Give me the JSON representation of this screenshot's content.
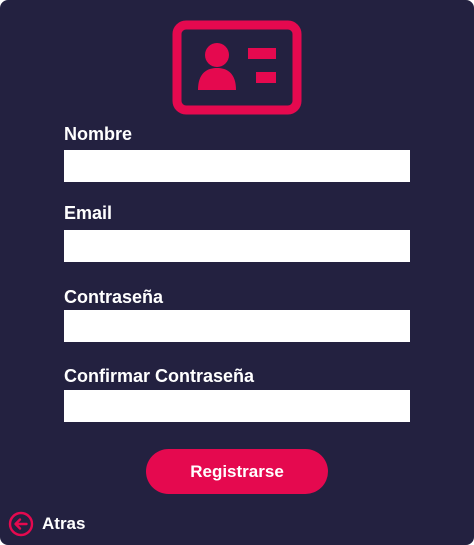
{
  "form": {
    "logo_icon": "id-card-icon",
    "fields": [
      {
        "label": "Nombre",
        "value": ""
      },
      {
        "label": "Email",
        "value": ""
      },
      {
        "label": "Contraseña",
        "value": ""
      },
      {
        "label": "Confirmar Contraseña",
        "value": ""
      }
    ],
    "submit_label": "Registrarse"
  },
  "footer": {
    "back_label": "Atras",
    "back_icon": "arrow-left-circle-icon"
  },
  "colors": {
    "background": "#232140",
    "accent": "#e5094f",
    "text": "#ffffff",
    "field": "#ffffff"
  }
}
